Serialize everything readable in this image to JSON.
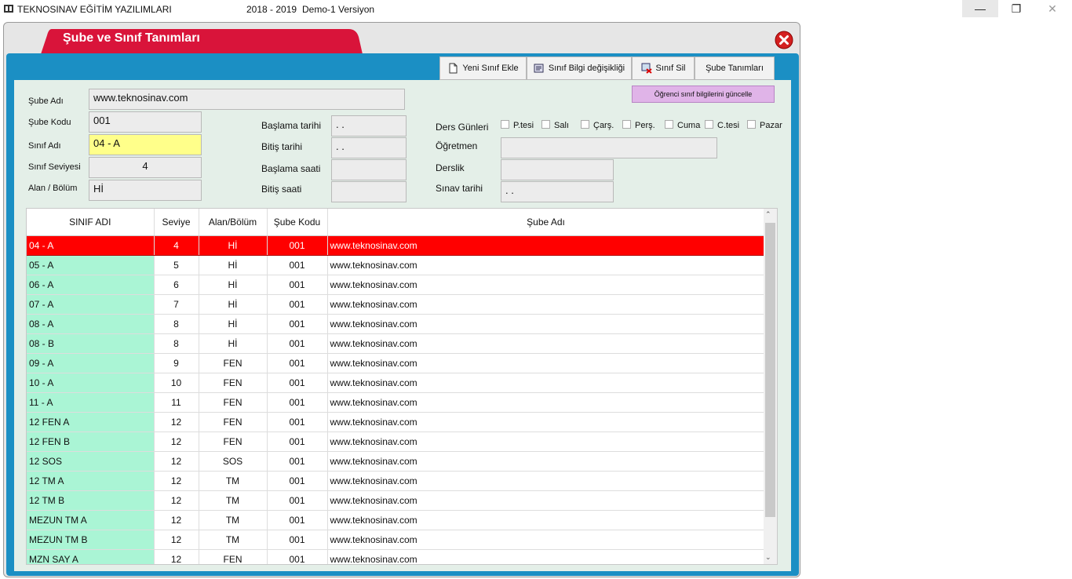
{
  "window": {
    "app_title": "TEKNOSINAV EĞİTİM YAZILIMLARI",
    "year": "2018 - 2019",
    "version": "Demo-1 Versiyon",
    "minimize": "—",
    "restore": "❐",
    "close": "✕"
  },
  "dialog": {
    "title": "Şube ve Sınıf Tanımları",
    "colors": {
      "frame": "#1b8fc4",
      "tab": "#d9143a",
      "selected_row": "#ff0000",
      "first_col": "#aaf5d5"
    }
  },
  "toolbar": {
    "new_label": "Yeni Sınıf Ekle",
    "edit_label": "Sınıf Bilgi değişikliği",
    "delete_label": "Sınıf Sil",
    "sube_label": "Şube Tanımları",
    "update_label": "Öğrenci sınıf bilgilerini güncelle"
  },
  "form": {
    "sube_adi_label": "Şube Adı",
    "sube_adi_value": "www.teknosinav.com",
    "sube_kodu_label": "Şube Kodu",
    "sube_kodu_value": "001",
    "sinif_adi_label": "Sınıf Adı",
    "sinif_adi_value": "04 - A",
    "sinif_seviyesi_label": "Sınıf Seviyesi",
    "sinif_seviyesi_value": "4",
    "alan_label": "Alan / Bölüm",
    "alan_value": "Hİ",
    "baslama_tarihi_label": "Başlama tarihi",
    "baslama_tarihi_value": ". .",
    "bitis_tarihi_label": "Bitiş tarihi",
    "bitis_tarihi_value": ". .",
    "baslama_saati_label": "Başlama saati",
    "bitis_saati_label": "Bitiş saati",
    "ders_gunleri_label": "Ders Günleri",
    "days": [
      "P.tesi",
      "Salı",
      "Çarş.",
      "Perş.",
      "Cuma",
      "C.tesi",
      "Pazar"
    ],
    "ogretmen_label": "Öğretmen",
    "derslik_label": "Derslik",
    "sinav_tarihi_label": "Sınav tarihi",
    "sinav_tarihi_value": ". ."
  },
  "grid": {
    "headers": [
      "SINIF ADI",
      "Seviye",
      "Alan/Bölüm",
      "Şube Kodu",
      "Şube Adı"
    ],
    "rows": [
      [
        "04 - A",
        "4",
        "Hİ",
        "001",
        "www.teknosinav.com"
      ],
      [
        "05 - A",
        "5",
        "Hİ",
        "001",
        "www.teknosinav.com"
      ],
      [
        "06 - A",
        "6",
        "Hİ",
        "001",
        "www.teknosinav.com"
      ],
      [
        "07 - A",
        "7",
        "Hİ",
        "001",
        "www.teknosinav.com"
      ],
      [
        "08 - A",
        "8",
        "Hİ",
        "001",
        "www.teknosinav.com"
      ],
      [
        "08 - B",
        "8",
        "Hİ",
        "001",
        "www.teknosinav.com"
      ],
      [
        "09 - A",
        "9",
        "FEN",
        "001",
        "www.teknosinav.com"
      ],
      [
        "10 - A",
        "10",
        "FEN",
        "001",
        "www.teknosinav.com"
      ],
      [
        "11 - A",
        "11",
        "FEN",
        "001",
        "www.teknosinav.com"
      ],
      [
        "12 FEN A",
        "12",
        "FEN",
        "001",
        "www.teknosinav.com"
      ],
      [
        "12 FEN B",
        "12",
        "FEN",
        "001",
        "www.teknosinav.com"
      ],
      [
        "12 SOS",
        "12",
        "SOS",
        "001",
        "www.teknosinav.com"
      ],
      [
        "12 TM A",
        "12",
        "TM",
        "001",
        "www.teknosinav.com"
      ],
      [
        "12 TM B",
        "12",
        "TM",
        "001",
        "www.teknosinav.com"
      ],
      [
        "MEZUN TM A",
        "12",
        "TM",
        "001",
        "www.teknosinav.com"
      ],
      [
        "MEZUN TM B",
        "12",
        "TM",
        "001",
        "www.teknosinav.com"
      ],
      [
        "MZN SAY A",
        "12",
        "FEN",
        "001",
        "www.teknosinav.com"
      ]
    ],
    "selected_index": 0
  }
}
